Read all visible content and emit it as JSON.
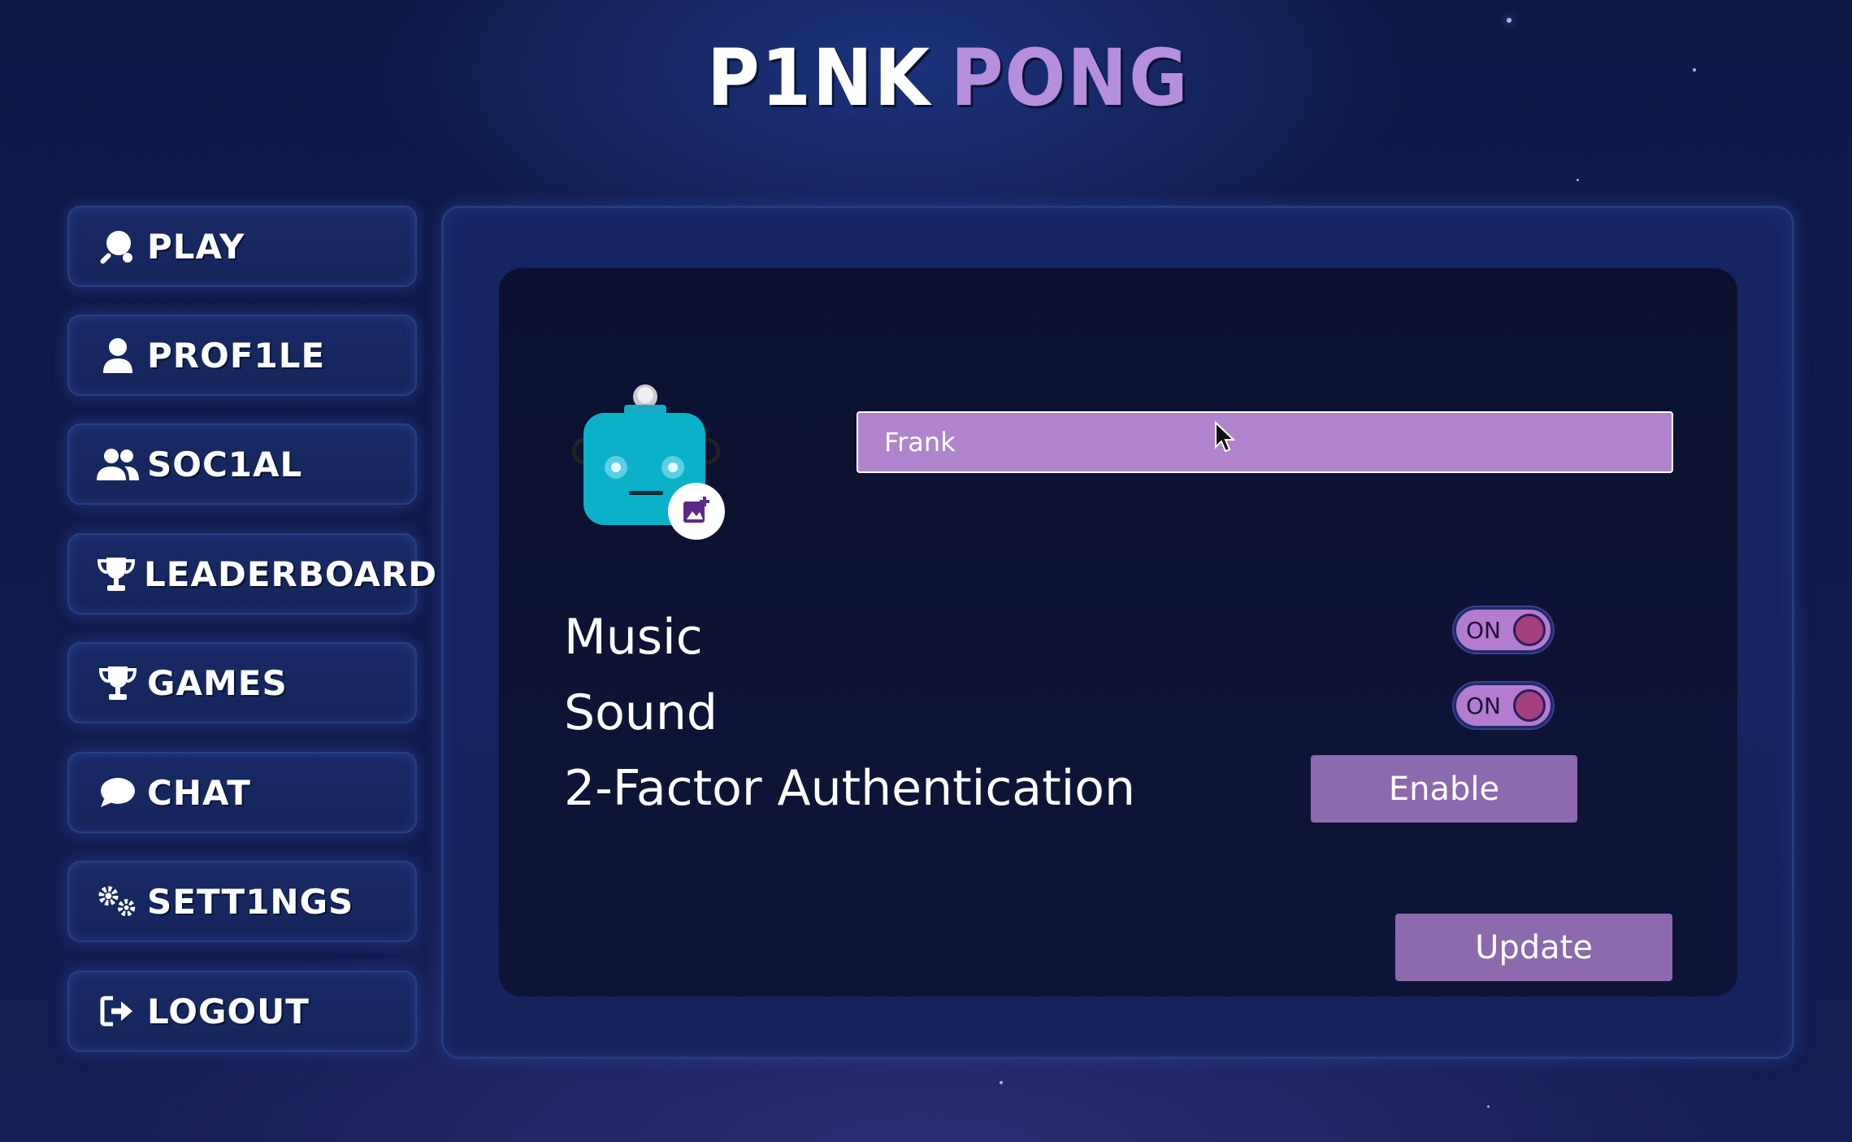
{
  "logo": {
    "part1": "P1NK",
    "part2": "PONG"
  },
  "sidebar": {
    "items": [
      {
        "label": "PLAY",
        "icon": "ping-pong-icon"
      },
      {
        "label": "PROF1LE",
        "icon": "user-icon"
      },
      {
        "label": "SOC1AL",
        "icon": "users-icon"
      },
      {
        "label": "LEADERBOARD",
        "icon": "trophy-icon"
      },
      {
        "label": "GAMES",
        "icon": "trophy-icon"
      },
      {
        "label": "CHAT",
        "icon": "chat-bubble-icon"
      },
      {
        "label": "SETT1NGS",
        "icon": "gears-icon"
      },
      {
        "label": "LOGOUT",
        "icon": "logout-icon"
      }
    ]
  },
  "settings": {
    "avatar_icon": "robot-avatar-icon",
    "avatar_add_icon": "add-image-icon",
    "username": "Frank",
    "music_label": "Music",
    "music_toggle": "ON",
    "sound_label": "Sound",
    "sound_toggle": "ON",
    "tfa_label": "2-Factor Authentication",
    "tfa_button": "Enable",
    "update_button": "Update"
  },
  "colors": {
    "accent": "#b084cc",
    "button": "#8c6aad",
    "background": "#111c4c"
  }
}
